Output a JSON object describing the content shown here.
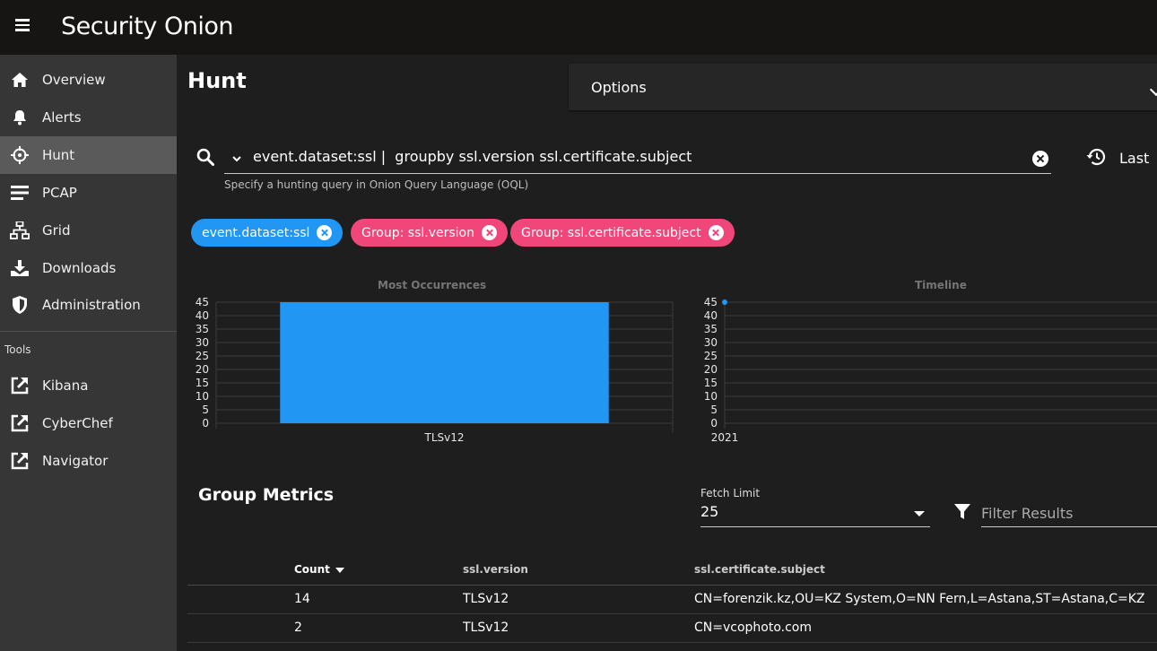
{
  "app": {
    "brand": "Security Onion"
  },
  "sidebar": {
    "items": [
      {
        "label": "Overview",
        "icon": "home-icon"
      },
      {
        "label": "Alerts",
        "icon": "bell-icon"
      },
      {
        "label": "Hunt",
        "icon": "crosshairs-icon",
        "active": true
      },
      {
        "label": "PCAP",
        "icon": "list-icon"
      },
      {
        "label": "Grid",
        "icon": "sitemap-icon"
      },
      {
        "label": "Downloads",
        "icon": "download-icon"
      },
      {
        "label": "Administration",
        "icon": "shield-icon"
      }
    ],
    "tools_title": "Tools",
    "tools": [
      {
        "label": "Kibana",
        "icon": "external-link-icon"
      },
      {
        "label": "CyberChef",
        "icon": "external-link-icon"
      },
      {
        "label": "Navigator",
        "icon": "external-link-icon"
      }
    ]
  },
  "page": {
    "title": "Hunt",
    "options_label": "Options"
  },
  "search": {
    "query": "event.dataset:ssl |  groupby ssl.version ssl.certificate.subject",
    "hint": "Specify a hunting query in Onion Query Language (OQL)",
    "date_range_label": "Last"
  },
  "chips": [
    {
      "label": "event.dataset:ssl",
      "color": "#2196f3"
    },
    {
      "label": "Group: ssl.version",
      "color": "#f1467a"
    },
    {
      "label": "Group: ssl.certificate.subject",
      "color": "#f1467a"
    }
  ],
  "charts": {
    "most_occurrences_title": "Most Occurrences",
    "timeline_title": "Timeline"
  },
  "chart_data": [
    {
      "type": "bar",
      "title": "Most Occurrences",
      "categories": [
        "TLSv12"
      ],
      "values": [
        45
      ],
      "ylim": [
        0,
        45
      ],
      "yticks": [
        0,
        5,
        10,
        15,
        20,
        25,
        30,
        35,
        40,
        45
      ],
      "color": "#2196f3",
      "grid": true
    },
    {
      "type": "scatter",
      "title": "Timeline",
      "x": [
        "2021"
      ],
      "y": [
        45
      ],
      "ylim": [
        0,
        45
      ],
      "yticks": [
        0,
        5,
        10,
        15,
        20,
        25,
        30,
        35,
        40,
        45
      ],
      "xticks": [
        "2021"
      ],
      "color": "#2196f3",
      "grid": true
    }
  ],
  "metrics": {
    "title": "Group Metrics",
    "fetch_limit_label": "Fetch Limit",
    "fetch_limit_value": "25",
    "filter_placeholder": "Filter Results",
    "columns": [
      "Count",
      "ssl.version",
      "ssl.certificate.subject"
    ],
    "rows": [
      {
        "count": "14",
        "version": "TLSv12",
        "subject": "CN=forenzik.kz,OU=KZ System,O=NN Fern,L=Astana,ST=Astana,C=KZ"
      },
      {
        "count": "2",
        "version": "TLSv12",
        "subject": "CN=vcophoto.com"
      }
    ]
  }
}
